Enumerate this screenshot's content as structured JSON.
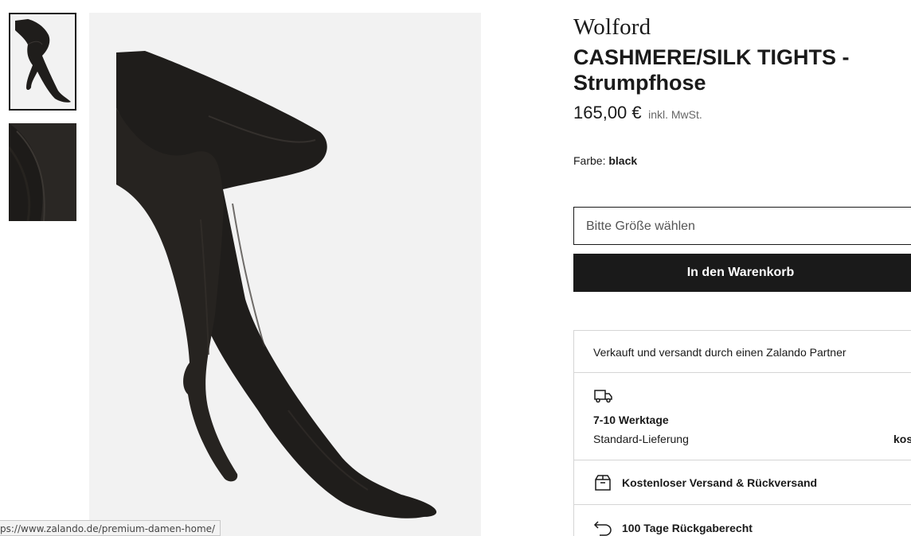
{
  "gallery": {
    "thumbnails": [
      {
        "alt": "tights-full-view"
      },
      {
        "alt": "tights-detail-view"
      }
    ]
  },
  "status_bar": {
    "url": "ps://www.zalando.de/premium-damen-home/"
  },
  "product": {
    "brand": "Wolford",
    "title": "CASHMERE/SILK TIGHTS - Strumpfhose",
    "price": "165,00 €",
    "vat_note": "inkl. MwSt.",
    "color_label": "Farbe:",
    "color_value": "black"
  },
  "purchase": {
    "size_placeholder": "Bitte Größe wählen",
    "cart_button": "In den Warenkorb"
  },
  "info_box": {
    "seller": "Verkauft und versandt durch einen Zalando Partner",
    "delivery_time": "7-10 Werktage",
    "delivery_type": "Standard-Lieferung",
    "delivery_cost": "kos",
    "shipping": "Kostenloser Versand & Rückversand",
    "returns": "100 Tage Rückgaberecht"
  },
  "icons": {
    "truck": "truck-icon",
    "box": "package-icon",
    "return": "return-arrow-icon"
  },
  "colors": {
    "primary": "#1a1a1a",
    "image_bg": "#f2f2f2",
    "border": "#d5d5d5"
  }
}
